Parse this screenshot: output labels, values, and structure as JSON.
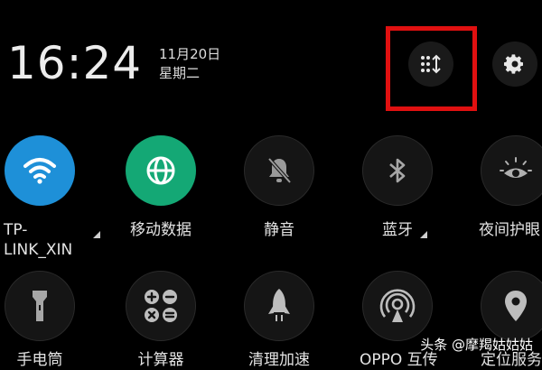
{
  "status": {
    "time": "16:24",
    "date": "11月20日",
    "weekday": "星期二"
  },
  "header": {
    "edit_icon": "grid-arrows-icon",
    "settings_icon": "gear-icon",
    "highlight_color": "#e01010"
  },
  "colors": {
    "wifi_on": "#1e90d8",
    "data_on": "#14a875",
    "tile_off": "#151515"
  },
  "tiles_row1": [
    {
      "label_line1": "TP-",
      "label_line2": "LINK_XIN",
      "icon": "wifi-icon",
      "state": "on"
    },
    {
      "label": "移动数据",
      "icon": "globe-icon",
      "state": "on"
    },
    {
      "label": "静音",
      "icon": "bell-off-icon",
      "state": "off"
    },
    {
      "label": "蓝牙",
      "icon": "bluetooth-icon",
      "state": "off"
    },
    {
      "label": "夜间护眼",
      "icon": "eye-sun-icon",
      "state": "off"
    }
  ],
  "tiles_row2": [
    {
      "label": "手电筒",
      "icon": "flashlight-icon",
      "state": "off"
    },
    {
      "label": "计算器",
      "icon": "calculator-icon",
      "state": "off"
    },
    {
      "label": "清理加速",
      "icon": "rocket-icon",
      "state": "off"
    },
    {
      "label": "OPPO 互传",
      "icon": "share-signal-icon",
      "state": "off"
    },
    {
      "label": "定位服务",
      "icon": "location-pin-icon",
      "state": "off"
    }
  ],
  "watermark": {
    "text": "头条 @摩羯姑姑姑"
  }
}
